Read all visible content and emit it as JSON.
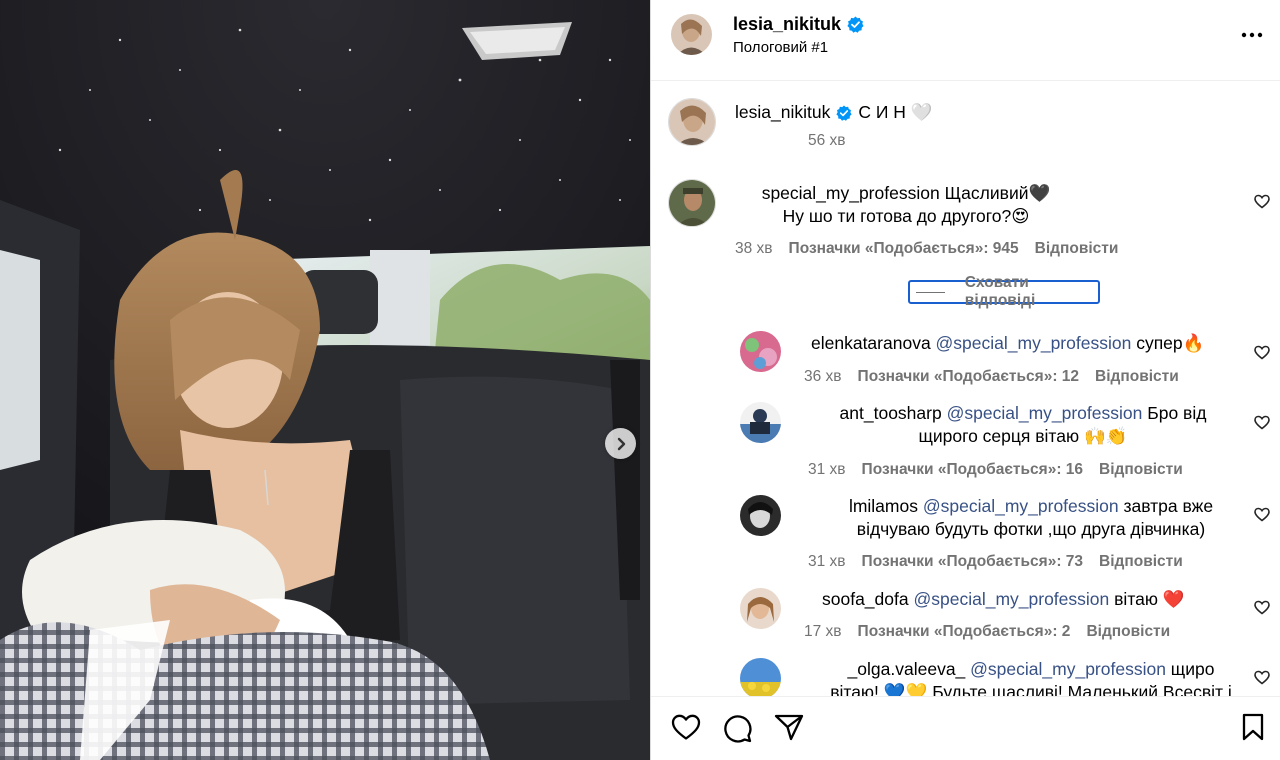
{
  "post": {
    "username": "lesia_nikituk",
    "location": "Пологовий #1",
    "caption": "С И Н 🤍",
    "caption_time": "56 хв"
  },
  "comment_main": {
    "username": "special_my_profession",
    "text_line1": "Щасливий🖤",
    "text_line2": "Ну шо ти готова до другого?😍",
    "time": "38 хв",
    "likes": "Позначки «Подобається»: 945",
    "reply": "Відповісти"
  },
  "hide_replies_label": "Сховати відповіді",
  "replies": [
    {
      "username": "elenkataranova",
      "mention": "@special_my_profession",
      "text": " супер🔥",
      "time": "36 хв",
      "likes": "Позначки «Подобається»: 12",
      "reply": "Відповісти"
    },
    {
      "username": "ant_toosharp",
      "mention": "@special_my_profession",
      "text": " Бро від",
      "text2": "щирого серця вітаю 🙌👏",
      "time": "31 хв",
      "likes": "Позначки «Подобається»: 16",
      "reply": "Відповісти"
    },
    {
      "username": "lmilamos",
      "mention": "@special_my_profession",
      "text": " завтра вже",
      "text2": "відчуваю будуть фотки ,що друга дівчинка)",
      "time": "31 хв",
      "likes": "Позначки «Подобається»: 73",
      "reply": "Відповісти"
    },
    {
      "username": "soofa_dofa",
      "mention": "@special_my_profession",
      "text": " вітаю ❤️",
      "time": "17 хв",
      "likes": "Позначки «Подобається»: 2",
      "reply": "Відповісти"
    },
    {
      "username": "_olga.valeeva_",
      "mention": "@special_my_profession",
      "text": " щиро",
      "text2": "вітаю! 💙💛 Будьте щасливі! Маленький Всесвіт і"
    }
  ],
  "colors": {
    "verified": "#0095f6",
    "mention": "#385185",
    "meta": "#737373",
    "focus_outline": "#1a5fd0"
  },
  "icons": {
    "verified": "verified-badge-icon",
    "more": "more-options-icon",
    "like": "heart-icon",
    "comment": "comment-icon",
    "share": "share-icon",
    "save": "bookmark-icon",
    "next": "chevron-right-icon"
  }
}
